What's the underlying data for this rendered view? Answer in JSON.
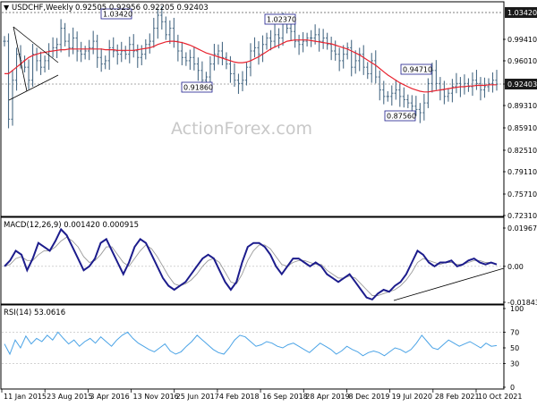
{
  "header": {
    "symbol": "USDCHF,Weekly",
    "ohlc": "0.92505 0.92956 0.92205 0.92403"
  },
  "watermark": "ActionForex.com",
  "colors": {
    "price_bar": "#4a6b86",
    "sma": "#e8232f",
    "macd": "#1c1c8c",
    "signal": "#9a9a9a",
    "rsi": "#4aa3e6",
    "label_border": "#1c1c8c",
    "current_price_box": "#1a1a1a",
    "grid": "#b8b8b8"
  },
  "chart_data": [
    {
      "type": "line",
      "panel": "price",
      "title": "USDCHF,Weekly",
      "ylim": [
        0.7231,
        1.0342
      ],
      "yticks": [
        "0.99410",
        "0.96010",
        "0.92403",
        "0.89310",
        "0.85910",
        "0.82510",
        "0.79110",
        "0.75710",
        "0.72310"
      ],
      "top_label": "1.03420",
      "current_price": 0.92403,
      "current_price_label": "0.92403",
      "x_tick_labels": [
        "11 Jan 2015",
        "23 Aug 2015",
        "3 Apr 2016",
        "13 Nov 2016",
        "25 Jun 2017",
        "4 Feb 2018",
        "16 Sep 2018",
        "28 Apr 2019",
        "8 Dec 2019",
        "19 Jul 2020",
        "28 Feb 2021",
        "10 Oct 2021"
      ],
      "annotations": [
        {
          "text": "1.03420",
          "x": "Nov 2016",
          "y": 1.0342
        },
        {
          "text": "0.91860",
          "x": "Mar 2018",
          "y": 0.9186
        },
        {
          "text": "1.02370",
          "x": "Dec 2018",
          "y": 1.0237
        },
        {
          "text": "0.94710",
          "x": "Mar 2021",
          "y": 0.9471
        },
        {
          "text": "0.87560",
          "x": "Jan 2021",
          "y": 0.8756
        }
      ],
      "series": [
        {
          "values": [
            0.99,
            0.87,
            0.93,
            0.97,
            0.96,
            0.95,
            0.93,
            0.97,
            0.96,
            0.95,
            0.96,
            0.975,
            0.98,
            0.985,
            1.01,
            0.99,
            0.98,
            0.995,
            0.975,
            0.97,
            0.975,
            0.98,
            0.99,
            0.965,
            0.955,
            0.96,
            0.98,
            0.975,
            0.97,
            0.975,
            0.97,
            0.985,
            0.975,
            0.965,
            0.97,
            0.985,
            0.99,
            1.01,
            1.03,
            1.02,
            1.0,
            1.01,
            0.99,
            0.975,
            0.965,
            0.96,
            0.965,
            0.955,
            0.945,
            0.93,
            0.935,
            0.955,
            0.97,
            0.975,
            0.965,
            0.955,
            0.94,
            0.93,
            0.925,
            0.93,
            0.95,
            0.975,
            0.98,
            0.97,
            0.985,
            0.995,
            0.99,
            1.0,
            0.995,
            1.02,
            1.01,
            1.005,
            0.99,
            0.985,
            0.99,
            0.995,
            0.995,
            1.0,
            0.99,
            0.995,
            0.985,
            0.975,
            0.97,
            0.96,
            0.97,
            0.98,
            0.95,
            0.96,
            0.97,
            0.95,
            0.94,
            0.96,
            0.935,
            0.915,
            0.905,
            0.905,
            0.91,
            0.915,
            0.905,
            0.9,
            0.895,
            0.89,
            0.885,
            0.88,
            0.895,
            0.925,
            0.945,
            0.925,
            0.915,
            0.905,
            0.91,
            0.92,
            0.925,
            0.92,
            0.925,
            0.92,
            0.93,
            0.925,
            0.915,
            0.92,
            0.925,
            0.93,
            0.924
          ]
        },
        {
          "name": "SMA",
          "values": [
            0.94,
            0.94,
            0.945,
            0.95,
            0.955,
            0.96,
            0.965,
            0.968,
            0.97,
            0.972,
            0.973,
            0.974,
            0.975,
            0.976,
            0.977,
            0.977,
            0.978,
            0.978,
            0.978,
            0.978,
            0.978,
            0.978,
            0.978,
            0.978,
            0.978,
            0.977,
            0.977,
            0.977,
            0.976,
            0.976,
            0.976,
            0.976,
            0.976,
            0.977,
            0.978,
            0.979,
            0.98,
            0.982,
            0.985,
            0.987,
            0.989,
            0.99,
            0.99,
            0.989,
            0.988,
            0.986,
            0.984,
            0.981,
            0.978,
            0.975,
            0.972,
            0.97,
            0.968,
            0.966,
            0.964,
            0.962,
            0.96,
            0.958,
            0.957,
            0.957,
            0.958,
            0.96,
            0.963,
            0.966,
            0.97,
            0.974,
            0.978,
            0.981,
            0.984,
            0.987,
            0.99,
            0.991,
            0.992,
            0.992,
            0.992,
            0.992,
            0.991,
            0.99,
            0.989,
            0.988,
            0.987,
            0.986,
            0.984,
            0.982,
            0.98,
            0.978,
            0.975,
            0.972,
            0.969,
            0.965,
            0.961,
            0.957,
            0.953,
            0.948,
            0.943,
            0.938,
            0.934,
            0.93,
            0.926,
            0.923,
            0.92,
            0.917,
            0.915,
            0.913,
            0.912,
            0.912,
            0.913,
            0.914,
            0.915,
            0.916,
            0.917,
            0.918,
            0.919,
            0.92,
            0.92,
            0.921,
            0.921,
            0.922,
            0.922,
            0.922,
            0.923,
            0.923,
            0.923
          ]
        }
      ]
    },
    {
      "type": "line",
      "panel": "macd",
      "title": "MACD(12,26,9) 0.001420 0.000915",
      "ylim": [
        -0.018439,
        0.019675
      ],
      "yticks": [
        "0.019675",
        "0.00",
        "-0.018439"
      ],
      "series": [
        {
          "name": "MACD",
          "values": [
            0.0,
            0.003,
            0.008,
            0.006,
            -0.002,
            0.004,
            0.012,
            0.01,
            0.008,
            0.013,
            0.019,
            0.016,
            0.01,
            0.004,
            -0.002,
            0.0,
            0.004,
            0.012,
            0.014,
            0.008,
            0.002,
            -0.004,
            0.002,
            0.01,
            0.014,
            0.012,
            0.006,
            0.0,
            -0.006,
            -0.01,
            -0.012,
            -0.01,
            -0.008,
            -0.004,
            0.0,
            0.004,
            0.006,
            0.004,
            -0.002,
            -0.008,
            -0.012,
            -0.008,
            0.002,
            0.01,
            0.012,
            0.012,
            0.01,
            0.006,
            0.0,
            -0.004,
            0.0,
            0.004,
            0.004,
            0.002,
            0.0,
            0.002,
            0.0,
            -0.004,
            -0.006,
            -0.008,
            -0.006,
            -0.004,
            -0.008,
            -0.012,
            -0.016,
            -0.017,
            -0.014,
            -0.012,
            -0.013,
            -0.01,
            -0.008,
            -0.004,
            0.002,
            0.008,
            0.006,
            0.002,
            0.0,
            0.002,
            0.002,
            0.003,
            0.0,
            0.001,
            0.003,
            0.004,
            0.002,
            0.001,
            0.002,
            0.001
          ]
        },
        {
          "name": "Signal",
          "values": [
            0.0,
            0.001,
            0.004,
            0.005,
            0.003,
            0.003,
            0.006,
            0.008,
            0.008,
            0.01,
            0.013,
            0.015,
            0.013,
            0.01,
            0.005,
            0.002,
            0.003,
            0.006,
            0.01,
            0.01,
            0.006,
            0.002,
            0.0,
            0.004,
            0.008,
            0.011,
            0.009,
            0.005,
            0.0,
            -0.005,
            -0.009,
            -0.01,
            -0.009,
            -0.007,
            -0.004,
            0.0,
            0.003,
            0.004,
            0.002,
            -0.003,
            -0.008,
            -0.009,
            -0.004,
            0.003,
            0.008,
            0.011,
            0.011,
            0.009,
            0.005,
            0.001,
            0.0,
            0.002,
            0.003,
            0.003,
            0.002,
            0.001,
            0.001,
            -0.002,
            -0.004,
            -0.006,
            -0.006,
            -0.005,
            -0.006,
            -0.009,
            -0.012,
            -0.015,
            -0.015,
            -0.014,
            -0.013,
            -0.012,
            -0.01,
            -0.007,
            -0.003,
            0.002,
            0.004,
            0.003,
            0.002,
            0.001,
            0.002,
            0.002,
            0.001,
            0.001,
            0.002,
            0.003,
            0.003,
            0.002,
            0.002,
            0.001
          ]
        }
      ]
    },
    {
      "type": "line",
      "panel": "rsi",
      "title": "RSI(14) 53.0616",
      "ylim": [
        0,
        100
      ],
      "yticks": [
        "100",
        "70",
        "50",
        "30",
        "0"
      ],
      "series": [
        {
          "name": "RSI",
          "values": [
            55,
            42,
            60,
            50,
            65,
            55,
            62,
            58,
            66,
            60,
            70,
            62,
            55,
            60,
            52,
            58,
            62,
            56,
            64,
            58,
            52,
            60,
            66,
            70,
            62,
            56,
            52,
            48,
            45,
            50,
            55,
            46,
            42,
            45,
            52,
            58,
            66,
            60,
            54,
            48,
            44,
            42,
            50,
            60,
            66,
            64,
            58,
            52,
            54,
            58,
            56,
            52,
            50,
            54,
            56,
            52,
            48,
            44,
            50,
            56,
            52,
            48,
            42,
            46,
            52,
            48,
            45,
            40,
            44,
            46,
            44,
            40,
            45,
            50,
            48,
            44,
            48,
            56,
            66,
            58,
            50,
            48,
            54,
            60,
            56,
            52,
            55,
            58,
            54,
            50,
            56,
            52,
            53
          ]
        }
      ]
    }
  ]
}
